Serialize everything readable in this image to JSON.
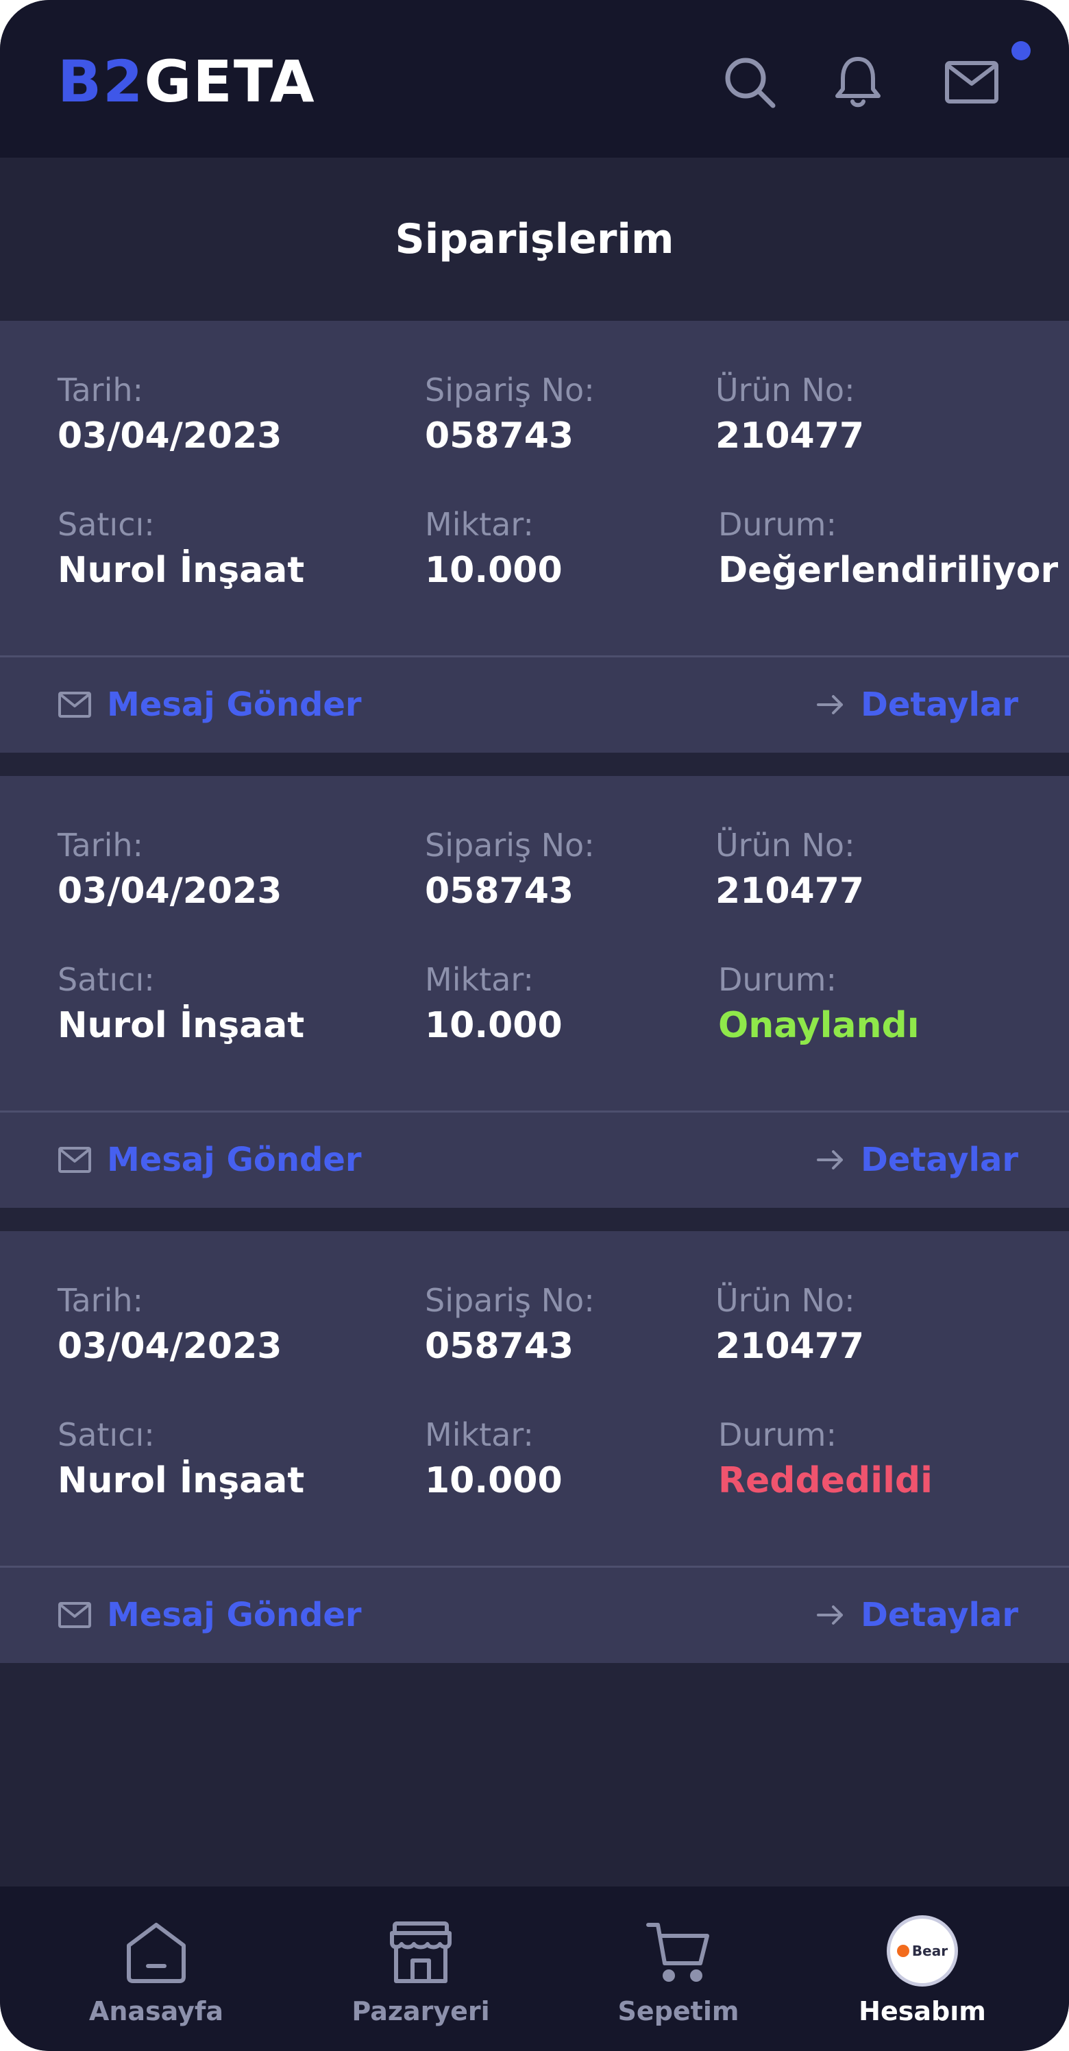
{
  "header": {
    "logo_part1": "B2",
    "logo_part2": "GETA"
  },
  "page": {
    "title": "Siparişlerim"
  },
  "labels": {
    "date": "Tarih:",
    "order_no": "Sipariş No:",
    "product_no": "Ürün No:",
    "seller": "Satıcı:",
    "quantity": "Miktar:",
    "status": "Durum:",
    "send_message": "Mesaj Gönder",
    "details": "Detaylar"
  },
  "orders": [
    {
      "date": "03/04/2023",
      "order_no": "058743",
      "product_no": "210477",
      "seller": "Nurol İnşaat",
      "quantity": "10.000",
      "status": "Değerlendiriliyor",
      "status_color": "#ffffff"
    },
    {
      "date": "03/04/2023",
      "order_no": "058743",
      "product_no": "210477",
      "seller": "Nurol İnşaat",
      "quantity": "10.000",
      "status": "Onaylandı",
      "status_color": "#8fe84a"
    },
    {
      "date": "03/04/2023",
      "order_no": "058743",
      "product_no": "210477",
      "seller": "Nurol İnşaat",
      "quantity": "10.000",
      "status": "Reddedildi",
      "status_color": "#f0546e"
    }
  ],
  "nav": {
    "items": [
      {
        "label": "Anasayfa",
        "icon": "home-icon"
      },
      {
        "label": "Pazaryeri",
        "icon": "store-icon"
      },
      {
        "label": "Sepetim",
        "icon": "cart-icon"
      },
      {
        "label": "Hesabım",
        "icon": "avatar",
        "active": true
      }
    ],
    "avatar_text": "Bear"
  },
  "colors": {
    "accent": "#3f57e8",
    "background": "#232439",
    "card": "#393a57",
    "header": "#15162a"
  }
}
